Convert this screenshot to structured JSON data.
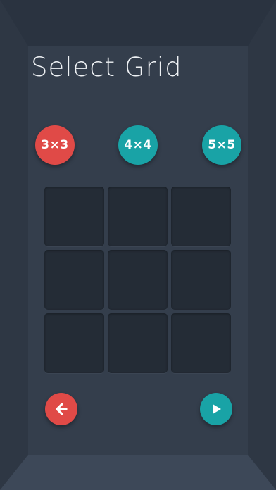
{
  "screen": {
    "title": "Select Grid"
  },
  "grid_options": [
    {
      "label": "3×3",
      "color": "#e04a47",
      "selected": true
    },
    {
      "label": "4×4",
      "color": "#19a3a6",
      "selected": false
    },
    {
      "label": "5×5",
      "color": "#19a3a6",
      "selected": false
    }
  ],
  "board": {
    "rows": 3,
    "cols": 3
  },
  "navigation": {
    "back_icon": "arrow-left-icon",
    "play_icon": "play-icon"
  },
  "colors": {
    "background": "#343e4c",
    "accent_red": "#e04a47",
    "accent_teal": "#19a3a6",
    "cell": "#242c36"
  }
}
